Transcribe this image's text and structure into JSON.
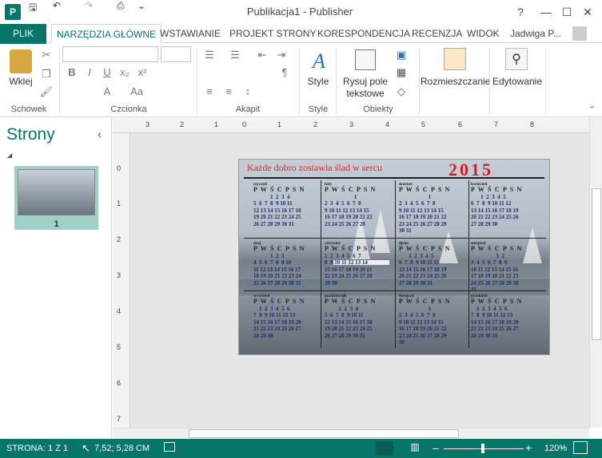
{
  "window": {
    "title": "Publikacja1 - Publisher",
    "user": "Jadwiga P...",
    "app_icon_letter": "P",
    "help": "?",
    "minimize": "—",
    "maximize": "☐",
    "close": "✕",
    "undo": "↶",
    "redo": "↷",
    "save": "🖫",
    "preview": "⎙",
    "customize": "⌄"
  },
  "tabs": {
    "file": "PLIK",
    "items": [
      "NARZĘDZIA GŁÓWNE",
      "WSTAWIANIE",
      "PROJEKT STRONY",
      "KORESPONDENCJA",
      "RECENZJA",
      "WIDOK"
    ]
  },
  "ribbon": {
    "clipboard": {
      "paste": "Wklej",
      "label": "Schowek"
    },
    "font": {
      "label": "Czcionka",
      "bold": "B",
      "italic": "I",
      "underline": "U",
      "subscript": "x₂",
      "superscript": "x²",
      "font_size": "Aa",
      "color": "A"
    },
    "paragraph": {
      "label": "Akapit",
      "pilcrow": "¶"
    },
    "styles": {
      "style": "Style",
      "label": "Style"
    },
    "objects": {
      "textbox": "Rysuj pole tekstowe",
      "label": "Obiekty"
    },
    "arrange": {
      "label": "Rozmieszczanie"
    },
    "editing": {
      "label": "Edytowanie"
    }
  },
  "pages_panel": {
    "title": "Strony",
    "collapse": "‹",
    "page_number": "1"
  },
  "ruler": {
    "top": [
      "3",
      "2",
      "1",
      "0",
      "1",
      "2",
      "3",
      "4",
      "5",
      "6",
      "7",
      "8"
    ],
    "left": [
      "0",
      "1",
      "2",
      "3",
      "4",
      "5",
      "6",
      "7"
    ]
  },
  "calendar": {
    "headline": "Każde dobro zostawia ślad w sercu",
    "year": "2015",
    "day_headers": "P W Ś C P S N",
    "months": [
      {
        "name": "styczeń",
        "rows": [
          "            1  2  3  4",
          "5  6  7  8  9 10 11",
          "12 13 14 15 16 17 18",
          "19 20 21 22 23 24 25",
          "26 27 28 29 30 31"
        ]
      },
      {
        "name": "luty",
        "rows": [
          "                     1",
          "2  3  4  5  6  7  8",
          "9 10 11 12 13 14 15",
          "16 17 18 19 20 21 22",
          "23 24 25 26 27 28"
        ]
      },
      {
        "name": "marzec",
        "rows": [
          "                     1",
          "2  3  4  5  6  7  8",
          "9 10 11 12 13 14 15",
          "16 17 18 19 20 21 22",
          "23 24 25 26 27 28 29",
          "30 31"
        ]
      },
      {
        "name": "kwiecień",
        "rows": [
          "       1  2  3  4  5",
          "6  7  8  9 10 11 12",
          "13 14 15 16 17 18 19",
          "20 21 22 23 24 25 26",
          "27 28 29 30"
        ]
      },
      {
        "name": "maj",
        "rows": [
          "            1  2  3",
          "4  5  6  7  8  9 10",
          "11 12 13 14 15 16 17",
          "18 19 20 21 22 23 24",
          "25 26 27 28 29 30 31"
        ]
      },
      {
        "name": "czerwiec",
        "rows": [
          "1  2  3  4  5  6  7",
          "8  9 10 11 12 13 14",
          "15 16 17 18 19 20 21",
          "22 23 24 25 26 27 28",
          "29 30"
        ]
      },
      {
        "name": "lipiec",
        "rows": [
          "       1  2  3  4  5",
          "6  7  8  9 10 11 12",
          "13 14 15 16 17 18 19",
          "20 21 22 23 24 25 26",
          "27 28 29 30 31"
        ]
      },
      {
        "name": "sierpień",
        "rows": [
          "                  1  2",
          "3  4  5  6  7  8  9",
          "10 11 12 13 14 15 16",
          "17 18 19 20 21 22 23",
          "24 25 26 27 28 29 30",
          "31"
        ]
      },
      {
        "name": "wrzesień",
        "rows": [
          "    1  2  3  4  5  6",
          "7  8  9 10 11 12 13",
          "14 15 16 17 18 19 20",
          "21 22 23 24 25 26 27",
          "28 29 30"
        ]
      },
      {
        "name": "październik",
        "rows": [
          "          1  2  3  4",
          "5  6  7  8  9 10 11",
          "12 13 14 15 16 17 18",
          "19 20 21 22 23 24 25",
          "26 27 28 29 30 31"
        ]
      },
      {
        "name": "listopad",
        "rows": [
          "                     1",
          "2  3  4  5  6  7  8",
          "9 10 11 12 13 14 15",
          "16 17 18 19 20 21 22",
          "23 24 25 26 27 28 29",
          "30"
        ]
      },
      {
        "name": "grudzień",
        "rows": [
          "    1  2  3  4  5  6",
          "7  8  9 10 11 12 13",
          "14 15 16 17 18 19 20",
          "21 22 23 24 25 26 27",
          "28 29 30 31"
        ]
      }
    ]
  },
  "status": {
    "page": "STRONA: 1 Z 1",
    "position": "7,52; 5,28 CM",
    "zoom": "120%",
    "zoom_out": "−",
    "zoom_in": "+"
  }
}
